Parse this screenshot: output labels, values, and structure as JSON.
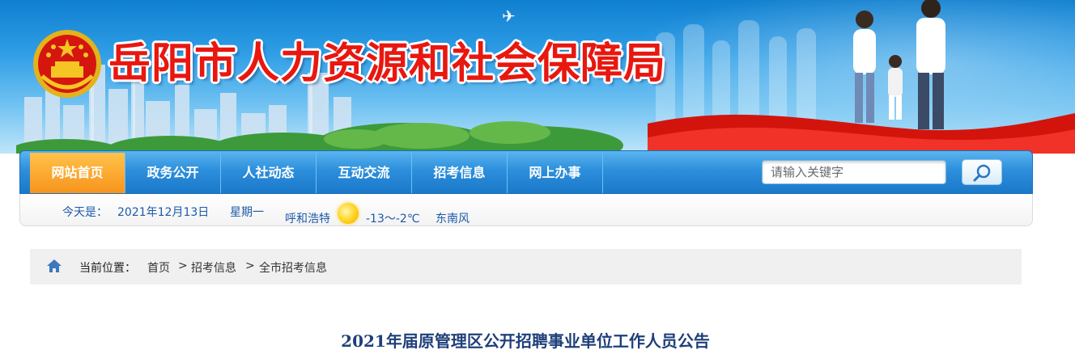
{
  "header": {
    "site_title": "岳阳市人力资源和社会保障局"
  },
  "nav": {
    "items": [
      {
        "label": "网站首页",
        "active": true
      },
      {
        "label": "政务公开",
        "active": false
      },
      {
        "label": "人社动态",
        "active": false
      },
      {
        "label": "互动交流",
        "active": false
      },
      {
        "label": "招考信息",
        "active": false
      },
      {
        "label": "网上办事",
        "active": false
      }
    ],
    "search_placeholder": "请输入关键字",
    "active_color": "#f7941d",
    "bar_color": "#2d8fdc"
  },
  "info_bar": {
    "today_label": "今天是：",
    "date": "2021年12月13日",
    "weekday": "星期一",
    "city": "呼和浩特",
    "weather_icon": "sun-icon",
    "temperature": "-13～-2℃",
    "wind": "东南风"
  },
  "breadcrumb": {
    "current_label": "当前位置：",
    "items": [
      "首页",
      "招考信息",
      "全市招考信息"
    ],
    "separator": ">"
  },
  "article": {
    "title": "2021年届原管理区公开招聘事业单位工作人员公告"
  }
}
